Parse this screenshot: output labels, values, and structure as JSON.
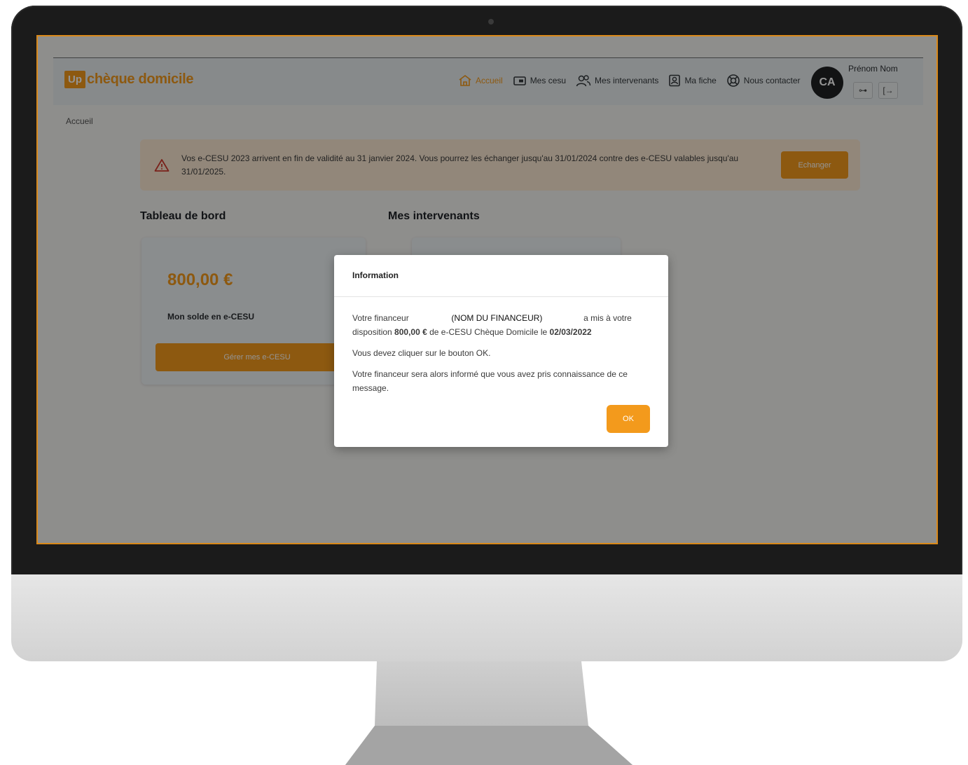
{
  "header": {
    "logo_badge": "Up",
    "logo_text": "chèque domicile",
    "nav": [
      {
        "label": "Accueil",
        "icon": "home-icon",
        "active": true
      },
      {
        "label": "Mes cesu",
        "icon": "wallet-icon"
      },
      {
        "label": "Mes intervenants",
        "icon": "users-icon"
      },
      {
        "label": "Ma fiche",
        "icon": "profile-card-icon"
      },
      {
        "label": "Nous contacter",
        "icon": "support-icon"
      }
    ],
    "user": {
      "initials": "CA",
      "name": "Prénom Nom",
      "key_button": "⊶",
      "logout_button": "[→"
    }
  },
  "breadcrumb": "Accueil",
  "alert": {
    "text": "Vos e-CESU 2023 arrivent en fin de validité au 31 janvier 2024. Vous pourrez les échanger jusqu'au 31/01/2024 contre des e-CESU valables jusqu'au 31/01/2025.",
    "button": "Echanger"
  },
  "dashboard": {
    "title": "Tableau de bord",
    "balance": "800,00 €",
    "balance_label": "Mon solde en e-CESU",
    "button": "Gérer mes e-CESU"
  },
  "intervenants": {
    "title": "Mes intervenants"
  },
  "modal": {
    "title": "Information",
    "line1_prefix": "Votre financeur",
    "financeur": "(NOM DU FINANCEUR)",
    "line1_suffix": "a mis à votre",
    "line2_prefix": "disposition",
    "amount": "800,00 €",
    "line2_middle": "de e-CESU Chèque Domicile le",
    "date": "02/03/2022",
    "p2": "Vous devez cliquer sur le bouton OK.",
    "p3": "Votre financeur sera alors informé que vous avez pris connaissance de ce message.",
    "ok": "OK"
  },
  "colors": {
    "accent": "#f39a1c",
    "frame": "#d9891a"
  }
}
